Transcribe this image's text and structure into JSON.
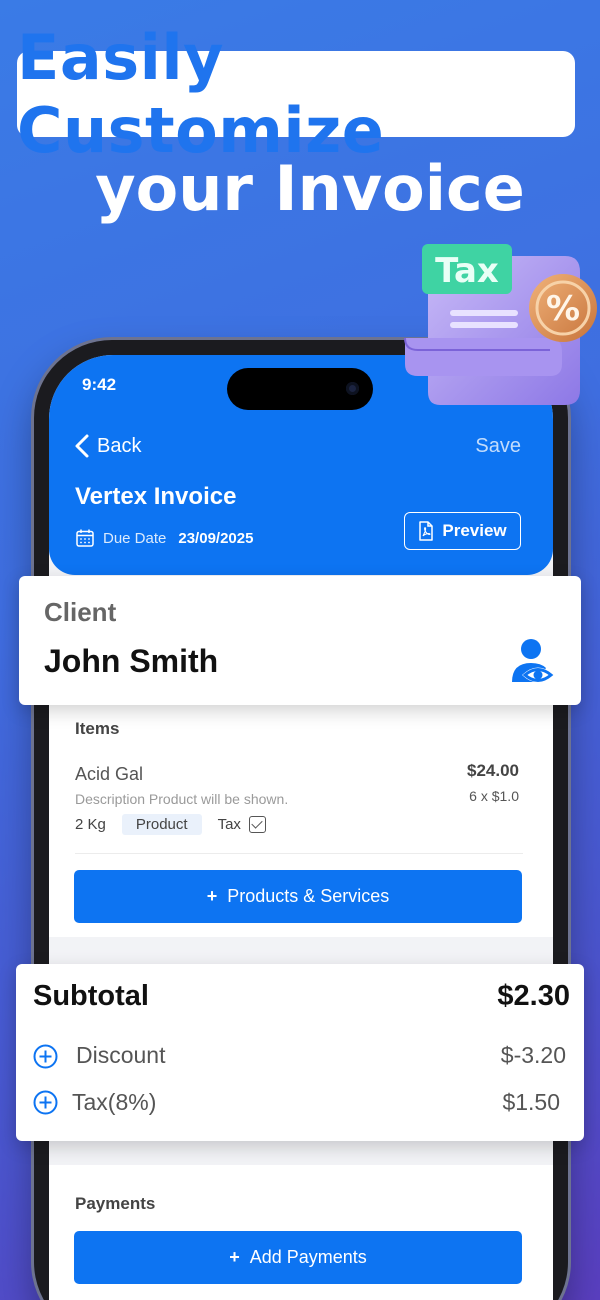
{
  "headline": {
    "line1": "Easily Customize",
    "line2": "your Invoice"
  },
  "illustration": {
    "tax_label": "Tax",
    "percent_symbol": "%"
  },
  "status_bar": {
    "time": "9:42"
  },
  "header": {
    "back_label": "Back",
    "save_label": "Save",
    "invoice_title": "Vertex Invoice",
    "due_date_label": "Due Date",
    "due_date_value": "23/09/2025",
    "preview_label": "Preview"
  },
  "client": {
    "label": "Client",
    "name": "John Smith"
  },
  "items": {
    "heading": "Items",
    "list": [
      {
        "name": "Acid Gal",
        "description": "Description Product will be shown.",
        "price": "$24.00",
        "quantity_line": "6 x $1.0",
        "unit": "2 Kg",
        "type": "Product",
        "tax_label": "Tax"
      }
    ],
    "add_button_label": "Products & Services"
  },
  "totals": {
    "subtotal_label": "Subtotal",
    "subtotal_value": "$2.30",
    "discount_label": "Discount",
    "discount_value": "$-3.20",
    "tax_label": "Tax(8%)",
    "tax_value": "$1.50"
  },
  "payments": {
    "heading": "Payments",
    "add_button_label": "Add Payments"
  },
  "colors": {
    "primary": "#0d74f2",
    "headline_blue": "#1f74ee",
    "tax_badge_green": "#3fd3a3",
    "coin_orange": "#d9894a"
  },
  "icons": [
    "chevron-left-icon",
    "calendar-icon",
    "pdf-icon",
    "user-eye-icon",
    "plus-circle-icon",
    "plus-icon",
    "checkbox-icon"
  ]
}
